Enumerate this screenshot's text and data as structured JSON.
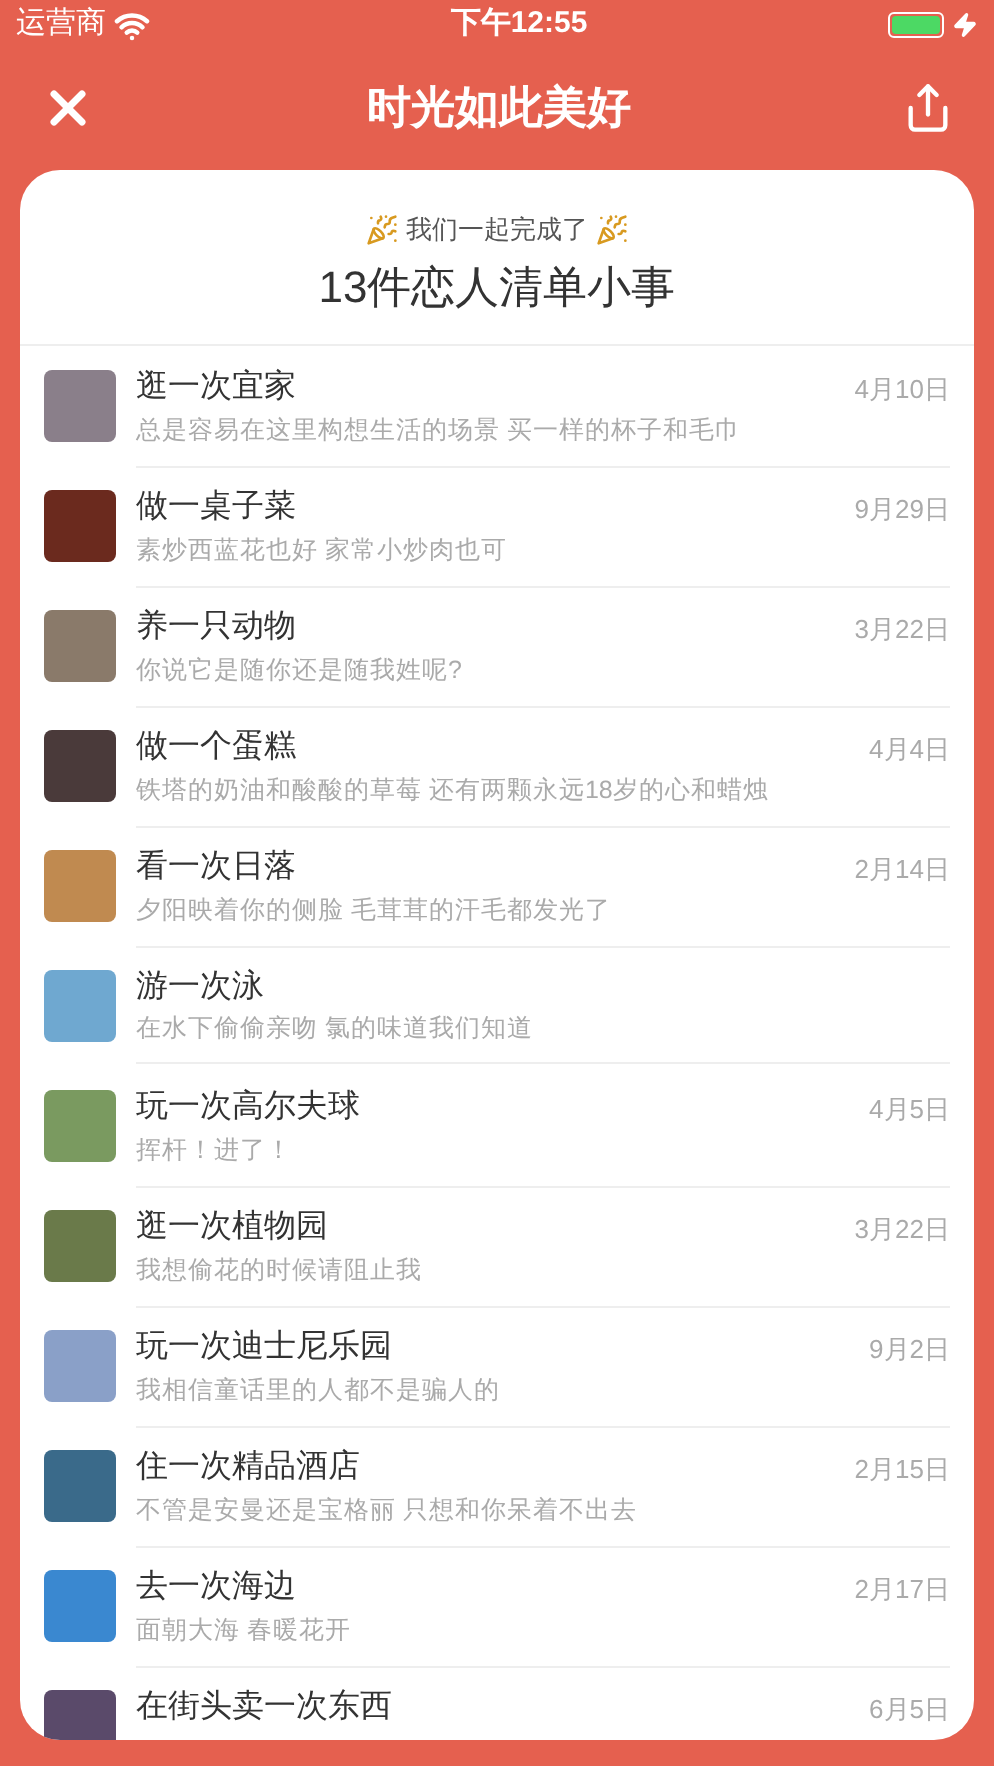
{
  "status_bar": {
    "carrier": "运营商",
    "time": "下午12:55"
  },
  "nav": {
    "title": "时光如此美好"
  },
  "summary": {
    "caption": "我们一起完成了",
    "headline": "13件恋人清单小事"
  },
  "items": [
    {
      "title": "逛一次宜家",
      "subtitle": "总是容易在这里构想生活的场景 买一样的杯子和毛巾",
      "date": "4月10日"
    },
    {
      "title": "做一桌子菜",
      "subtitle": "素炒西蓝花也好 家常小炒肉也可",
      "date": "9月29日"
    },
    {
      "title": "养一只动物",
      "subtitle": "你说它是随你还是随我姓呢?",
      "date": "3月22日"
    },
    {
      "title": "做一个蛋糕",
      "subtitle": "铁塔的奶油和酸酸的草莓 还有两颗永远18岁的心和蜡烛",
      "date": "4月4日"
    },
    {
      "title": "看一次日落",
      "subtitle": "夕阳映着你的侧脸 毛茸茸的汗毛都发光了",
      "date": "2月14日"
    },
    {
      "title": "游一次泳",
      "subtitle": "在水下偷偷亲吻 氯的味道我们知道"
    },
    {
      "title": "玩一次高尔夫球",
      "subtitle": "挥杆！进了！",
      "date": "4月5日"
    },
    {
      "title": "逛一次植物园",
      "subtitle": "我想偷花的时候请阻止我",
      "date": "3月22日"
    },
    {
      "title": "玩一次迪士尼乐园",
      "subtitle": "我相信童话里的人都不是骗人的",
      "date": "9月2日"
    },
    {
      "title": "住一次精品酒店",
      "subtitle": "不管是安曼还是宝格丽 只想和你呆着不出去",
      "date": "2月15日"
    },
    {
      "title": "去一次海边",
      "subtitle": "面朝大海 春暖花开",
      "date": "2月17日"
    },
    {
      "title": "在街头卖一次东西",
      "date": "6月5日"
    }
  ]
}
